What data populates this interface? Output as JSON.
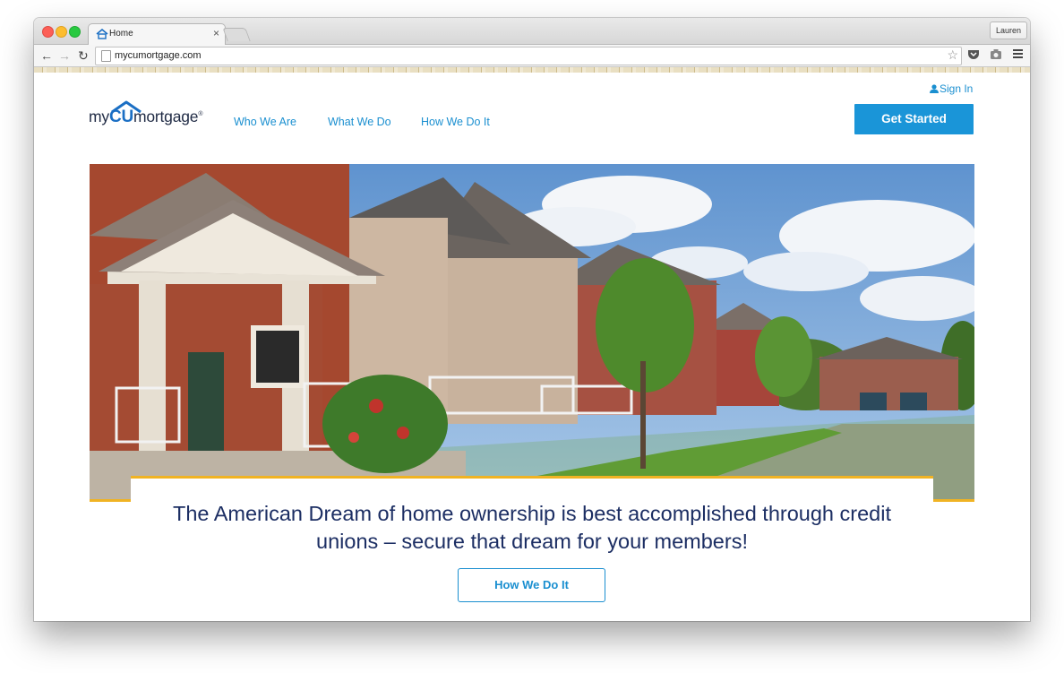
{
  "browser": {
    "tab": {
      "title": "Home",
      "close": "×"
    },
    "profile": "Lauren",
    "url": "mycumortgage.com"
  },
  "site": {
    "logo": {
      "prefix": "my",
      "cu": "CU",
      "suffix": "mortgage",
      "mark": "®"
    },
    "sign_in": "Sign In",
    "nav": [
      {
        "label": "Who We Are"
      },
      {
        "label": "What We Do"
      },
      {
        "label": "How We Do It"
      }
    ],
    "cta": "Get Started",
    "hero": {
      "headline": "The American Dream of home ownership is best accomplished through credit unions – secure that dream for your members!",
      "button": "How We Do It"
    }
  },
  "colors": {
    "accent_blue": "#1a95d8",
    "navy_text": "#1c2e63",
    "gold": "#f0b323"
  }
}
